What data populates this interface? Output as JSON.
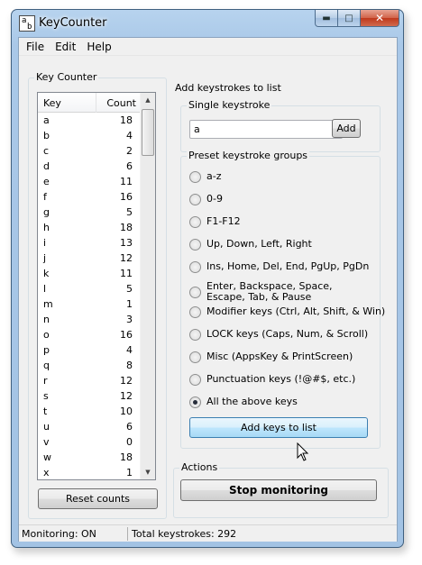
{
  "window": {
    "title": "KeyCounter"
  },
  "menu": [
    "File",
    "Edit",
    "Help"
  ],
  "key_counter": {
    "group_title": "Key Counter",
    "columns": [
      "Key",
      "Count"
    ],
    "rows": [
      {
        "key": "a",
        "count": "18"
      },
      {
        "key": "b",
        "count": "4"
      },
      {
        "key": "c",
        "count": "2"
      },
      {
        "key": "d",
        "count": "6"
      },
      {
        "key": "e",
        "count": "11"
      },
      {
        "key": "f",
        "count": "16"
      },
      {
        "key": "g",
        "count": "5"
      },
      {
        "key": "h",
        "count": "18"
      },
      {
        "key": "i",
        "count": "13"
      },
      {
        "key": "j",
        "count": "12"
      },
      {
        "key": "k",
        "count": "11"
      },
      {
        "key": "l",
        "count": "5"
      },
      {
        "key": "m",
        "count": "1"
      },
      {
        "key": "n",
        "count": "3"
      },
      {
        "key": "o",
        "count": "16"
      },
      {
        "key": "p",
        "count": "4"
      },
      {
        "key": "q",
        "count": "8"
      },
      {
        "key": "r",
        "count": "12"
      },
      {
        "key": "s",
        "count": "12"
      },
      {
        "key": "t",
        "count": "10"
      },
      {
        "key": "u",
        "count": "6"
      },
      {
        "key": "v",
        "count": "0"
      },
      {
        "key": "w",
        "count": "18"
      },
      {
        "key": "x",
        "count": "1"
      }
    ],
    "reset_label": "Reset counts"
  },
  "add_keystrokes": {
    "group_title": "Add keystrokes to list",
    "single": {
      "title": "Single keystroke",
      "selected": "a",
      "add_label": "Add"
    },
    "preset": {
      "title": "Preset keystroke groups",
      "options": [
        {
          "label": "a-z",
          "checked": false
        },
        {
          "label": "0-9",
          "checked": false
        },
        {
          "label": "F1-F12",
          "checked": false
        },
        {
          "label": "Up, Down, Left, Right",
          "checked": false
        },
        {
          "label": "Ins, Home, Del, End, PgUp, PgDn",
          "checked": false
        },
        {
          "label": "Enter, Backspace, Space, Escape, Tab, & Pause",
          "checked": false
        },
        {
          "label": "Modifier keys (Ctrl, Alt, Shift, & Win)",
          "checked": false
        },
        {
          "label": "LOCK keys (Caps, Num, & Scroll)",
          "checked": false
        },
        {
          "label": "Misc (AppsKey & PrintScreen)",
          "checked": false
        },
        {
          "label": "Punctuation keys (!@#$, etc.)",
          "checked": false
        },
        {
          "label": "All the above keys",
          "checked": true
        }
      ],
      "add_label": "Add keys to list"
    }
  },
  "actions": {
    "group_title": "Actions",
    "stop_label": "Stop monitoring"
  },
  "status": {
    "monitoring": "Monitoring: ON",
    "total": "Total keystrokes: 292"
  }
}
